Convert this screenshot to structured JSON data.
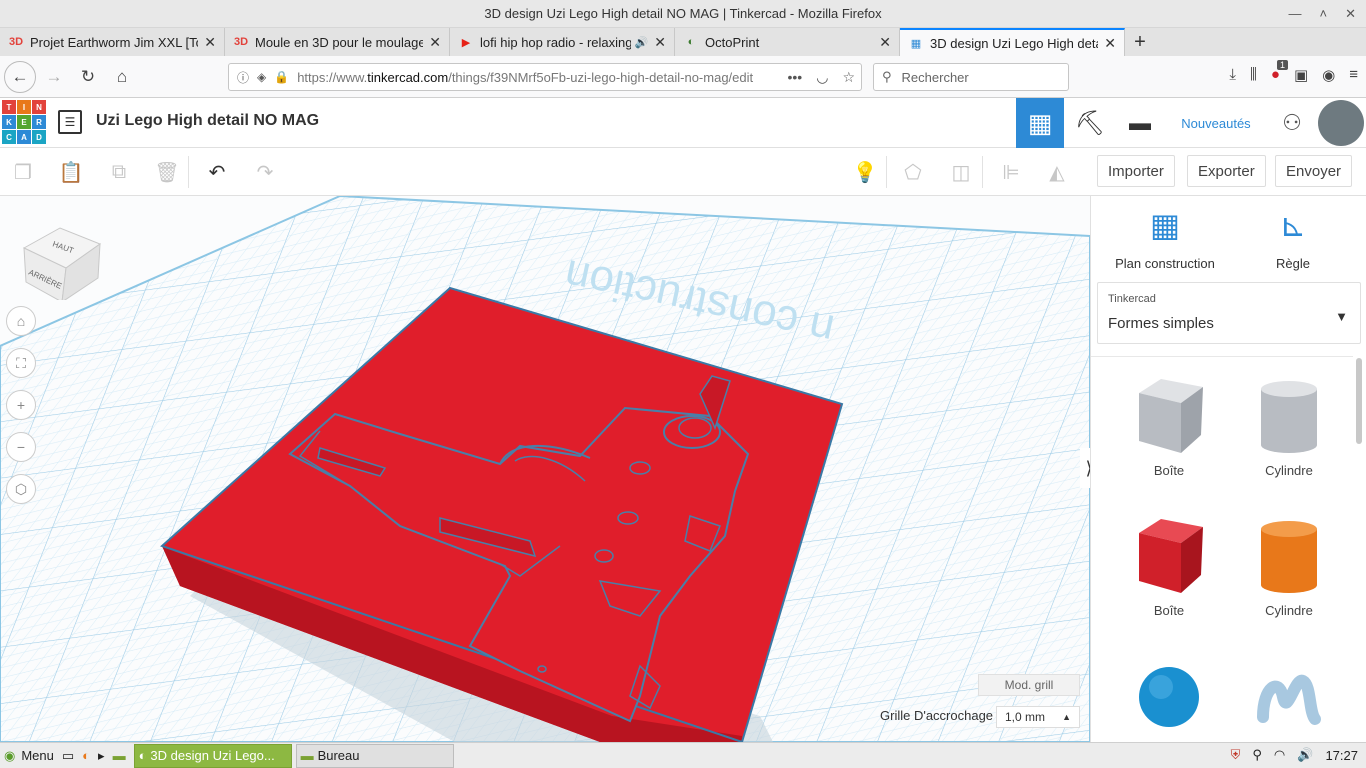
{
  "window": {
    "title": "3D design Uzi Lego High detail NO MAG | Tinkercad - Mozilla Firefox"
  },
  "tabs": [
    {
      "label": "Projet Earthworm Jim XXL [To",
      "favicon": "3D",
      "favicon_color": "#e2423b"
    },
    {
      "label": "Moule en 3D pour le moulage",
      "favicon": "3D",
      "favicon_color": "#e2423b"
    },
    {
      "label": "lofi hip hop radio - relaxing",
      "favicon": "▶",
      "favicon_color": "#e62117",
      "sound": "🔊"
    },
    {
      "label": "OctoPrint",
      "favicon": "◐",
      "favicon_color": "#3b7a2e"
    },
    {
      "label": "3D design Uzi Lego High deta",
      "favicon": "▦",
      "favicon_color": "#2d8ad6",
      "active": true
    }
  ],
  "browser": {
    "url_prefix": "https://www.",
    "url_domain": "tinkercad.com",
    "url_path": "/things/f39NMrf5oFb-uzi-lego-high-detail-no-mag/edit",
    "search_placeholder": "Rechercher",
    "badge_count": "1"
  },
  "tinkercad": {
    "logo_letters": [
      "TIN",
      "KER",
      "CAD"
    ],
    "design_title": "Uzi Lego High detail NO MAG",
    "nouveautes": "Nouveautés",
    "toolbar": {
      "import": "Importer",
      "export": "Exporter",
      "send": "Envoyer"
    },
    "viewcube": {
      "top": "HAUT",
      "back": "ARRIÈRE"
    },
    "workplane_label": "n construction",
    "mod_grill": "Mod. grill",
    "snap_label": "Grille D'accrochage",
    "snap_value": "1,0 mm"
  },
  "right_panel": {
    "tools": [
      {
        "label": "Plan construction",
        "icon": "workplane-icon"
      },
      {
        "label": "Règle",
        "icon": "ruler-icon"
      }
    ],
    "library_source": "Tinkercad",
    "library_selected": "Formes simples",
    "shapes": [
      {
        "label": "Boîte",
        "kind": "box-hole",
        "color": "#b8bcc2"
      },
      {
        "label": "Cylindre",
        "kind": "cylinder-hole",
        "color": "#b8bcc2"
      },
      {
        "label": "Boîte",
        "kind": "box",
        "color": "#d0202a"
      },
      {
        "label": "Cylindre",
        "kind": "cylinder",
        "color": "#e8781a"
      },
      {
        "label": "",
        "kind": "sphere",
        "color": "#1a90d0"
      },
      {
        "label": "",
        "kind": "scribble",
        "color": "#a8c8e0"
      }
    ]
  },
  "taskbar": {
    "menu": "Menu",
    "windows": [
      {
        "label": "3D design Uzi Lego...",
        "active": true
      },
      {
        "label": "Bureau",
        "active": false
      }
    ],
    "clock": "17:27"
  },
  "colors": {
    "accent": "#2d8ad6",
    "model_red": "#e01e2b",
    "grid": "#a9d6ee"
  }
}
